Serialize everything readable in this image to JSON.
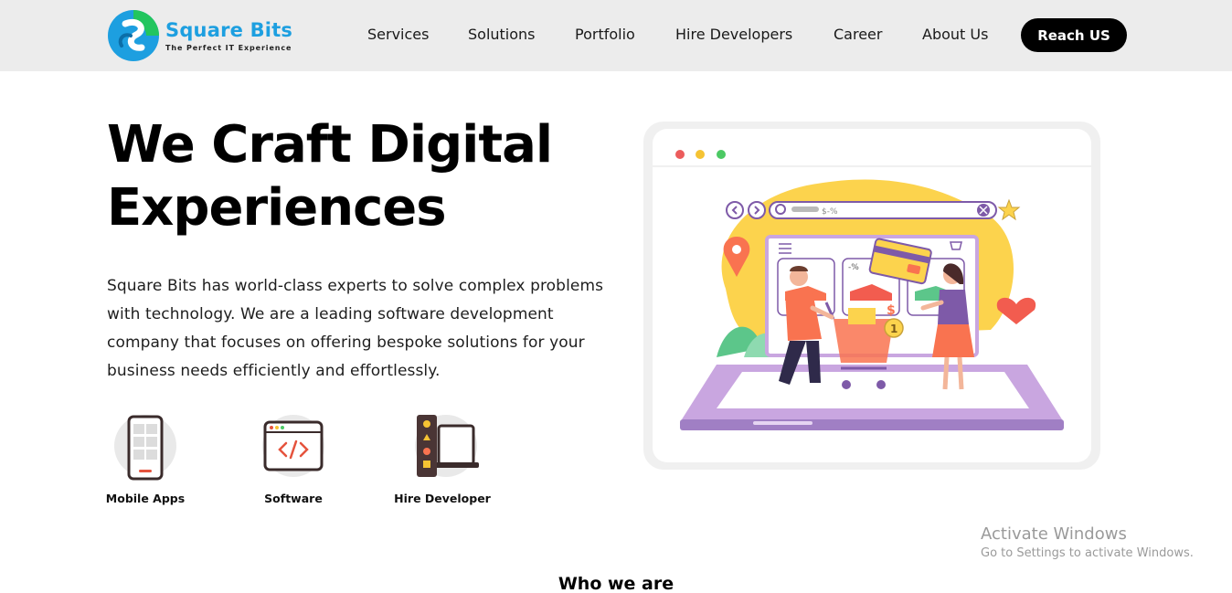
{
  "header": {
    "logo": {
      "name": "Square Bits",
      "tagline": "The Perfect IT Experience",
      "colors": {
        "blue": "#1d9fe0",
        "green": "#22c55e"
      }
    },
    "nav": [
      {
        "label": "Services"
      },
      {
        "label": "Solutions"
      },
      {
        "label": "Portfolio"
      },
      {
        "label": "Hire Developers"
      },
      {
        "label": "Career"
      },
      {
        "label": "About Us"
      }
    ],
    "cta_label": "Reach US"
  },
  "hero": {
    "title_line1": "We Craft Digital",
    "title_line2": "Experiences",
    "description": "Square Bits has world-class experts to solve complex problems with technology. We are a leading software development company that focuses on offering bespoke solutions for your business needs efficiently and effortlessly."
  },
  "features": [
    {
      "label": "Mobile Apps",
      "icon": "mobile-phone-icon"
    },
    {
      "label": "Software",
      "icon": "code-window-icon"
    },
    {
      "label": "Hire Developer",
      "icon": "developer-desk-icon"
    }
  ],
  "illustration": {
    "search_text": "$-%",
    "price_tag": "-%",
    "dollar": "$",
    "badge_count": "1",
    "colors": {
      "purple": "#c9a6e0",
      "yellow": "#fcd34d",
      "orange": "#f97350",
      "green": "#5cc68a"
    }
  },
  "watermark": {
    "title": "Activate Windows",
    "subtitle": "Go to Settings to activate Windows."
  },
  "section": {
    "title": "Who we are"
  }
}
